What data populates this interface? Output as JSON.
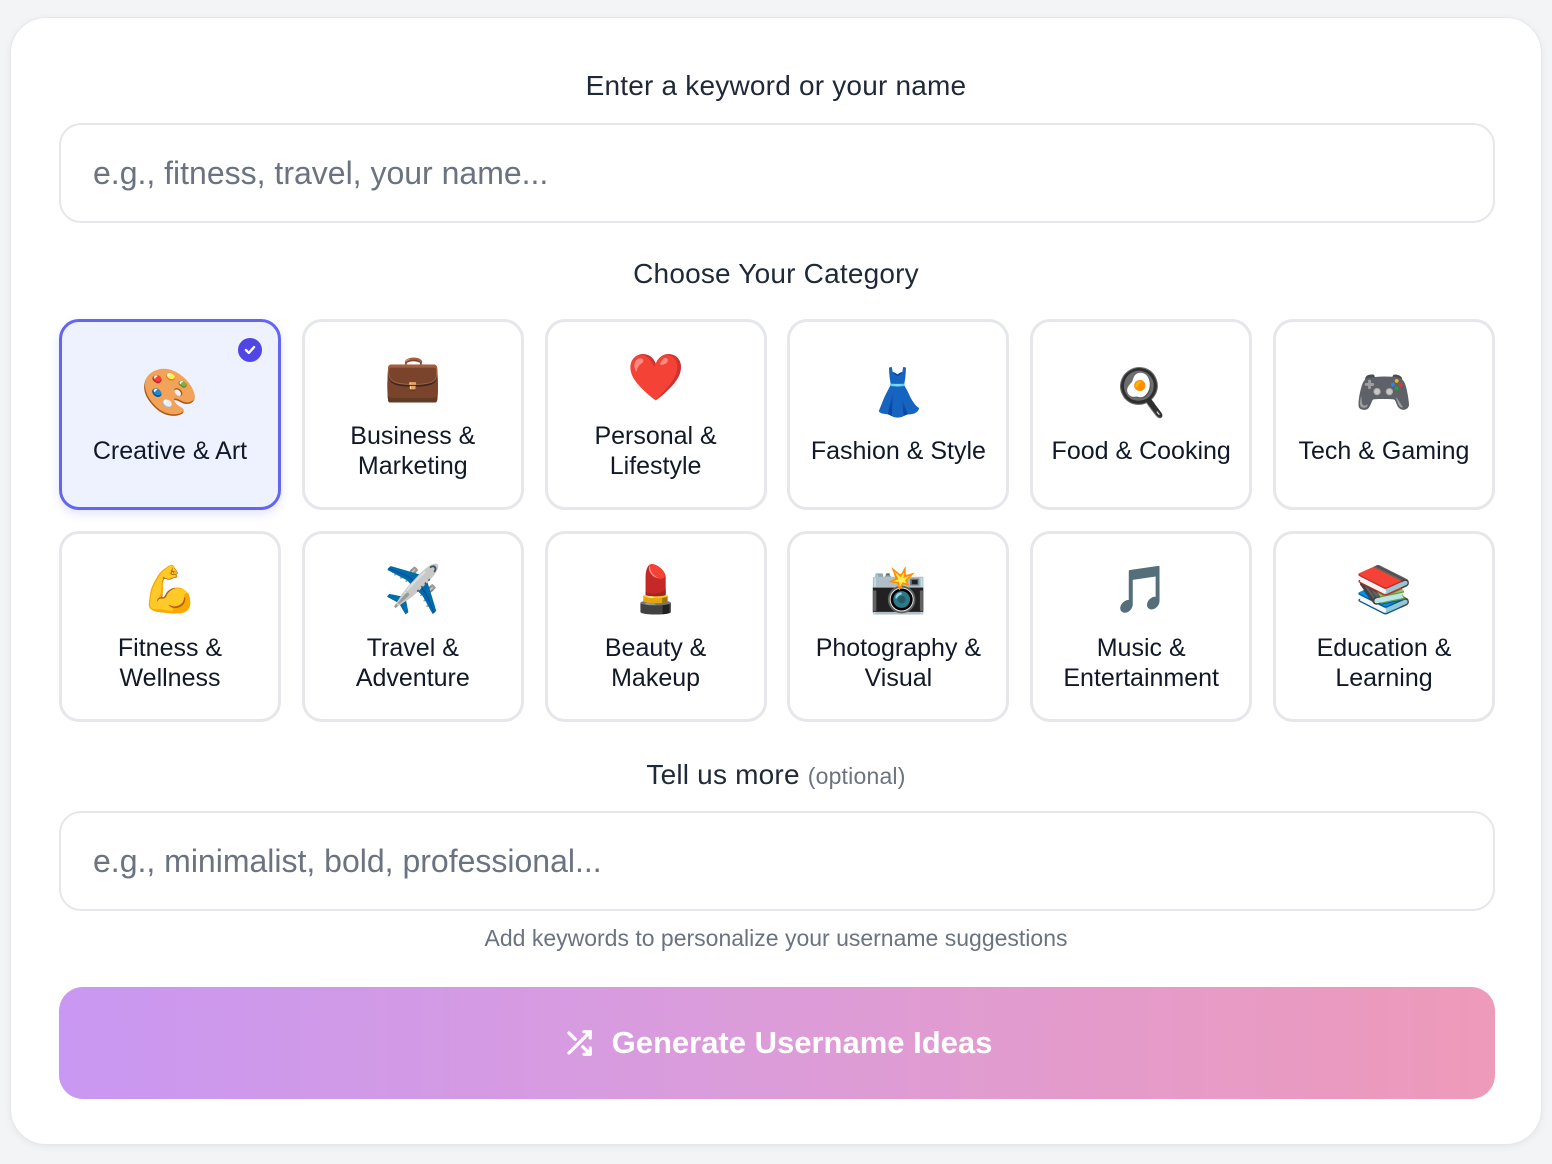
{
  "keyword": {
    "label": "Enter a keyword or your name",
    "placeholder": "e.g., fitness, travel, your name...",
    "value": ""
  },
  "category": {
    "label": "Choose Your Category",
    "selected_index": 0,
    "items": [
      {
        "emoji": "🎨",
        "label": "Creative & Art",
        "icon": "palette-icon"
      },
      {
        "emoji": "💼",
        "label": "Business & Marketing",
        "icon": "briefcase-icon"
      },
      {
        "emoji": "❤️",
        "label": "Personal & Lifestyle",
        "icon": "heart-icon"
      },
      {
        "emoji": "👗",
        "label": "Fashion & Style",
        "icon": "dress-icon"
      },
      {
        "emoji": "🍳",
        "label": "Food & Cooking",
        "icon": "frying-pan-icon"
      },
      {
        "emoji": "🎮",
        "label": "Tech & Gaming",
        "icon": "game-controller-icon"
      },
      {
        "emoji": "💪",
        "label": "Fitness & Wellness",
        "icon": "flexed-biceps-icon"
      },
      {
        "emoji": "✈️",
        "label": "Travel & Adventure",
        "icon": "airplane-icon"
      },
      {
        "emoji": "💄",
        "label": "Beauty & Makeup",
        "icon": "lipstick-icon"
      },
      {
        "emoji": "📸",
        "label": "Photography & Visual",
        "icon": "camera-flash-icon"
      },
      {
        "emoji": "🎵",
        "label": "Music & Entertainment",
        "icon": "music-note-icon"
      },
      {
        "emoji": "📚",
        "label": "Education & Learning",
        "icon": "books-icon"
      }
    ]
  },
  "more": {
    "label": "Tell us more",
    "optional": "(optional)",
    "placeholder": "e.g., minimalist, bold, professional...",
    "value": "",
    "helper": "Add keywords to personalize your username suggestions"
  },
  "generate": {
    "label": "Generate Username Ideas",
    "icon": "shuffle-icon"
  },
  "colors": {
    "accent": "#6366f1",
    "selected_bg": "#eef2ff",
    "button_gradient_start": "#c998f2",
    "button_gradient_end": "#ee9ab9"
  }
}
